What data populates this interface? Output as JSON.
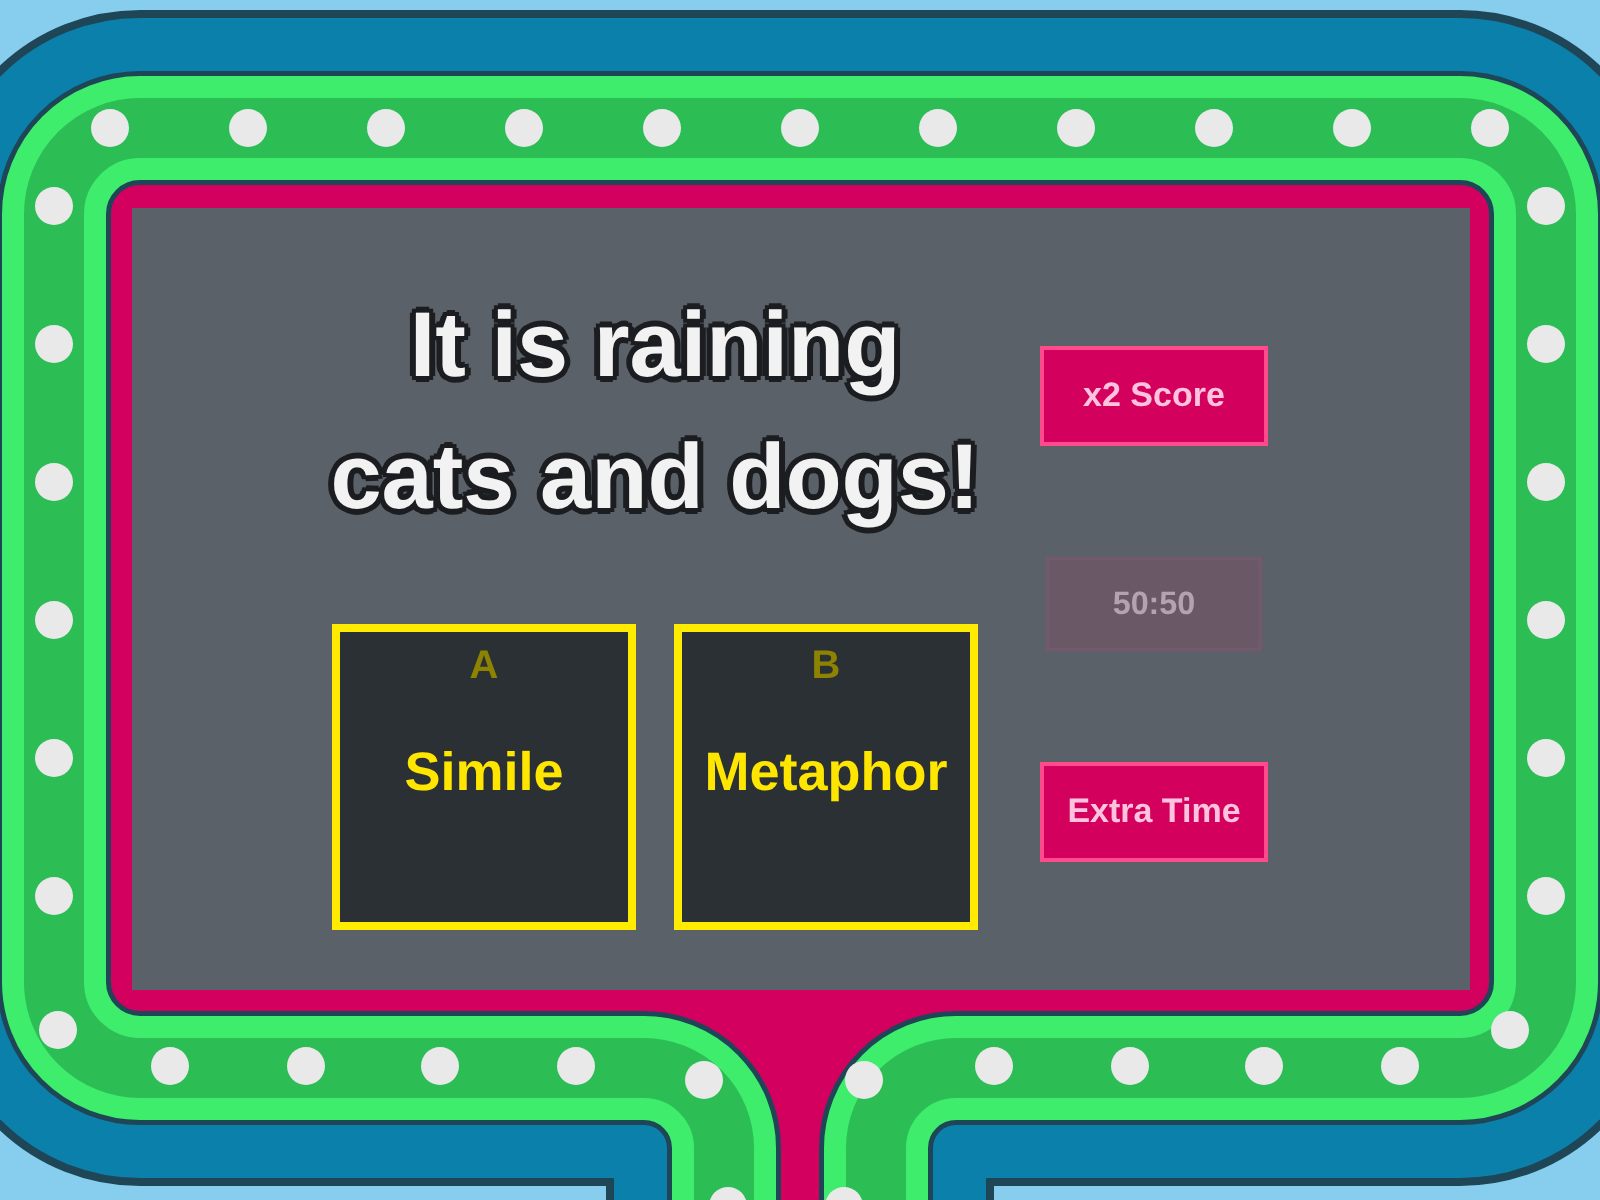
{
  "question": "It is raining cats and dogs!",
  "answers": [
    {
      "letter": "A",
      "text": "Simile"
    },
    {
      "letter": "B",
      "text": "Metaphor"
    }
  ],
  "powerups": [
    {
      "label": "x2 Score",
      "disabled": false
    },
    {
      "label": "50:50",
      "disabled": true
    },
    {
      "label": "Extra Time",
      "disabled": false
    }
  ]
}
